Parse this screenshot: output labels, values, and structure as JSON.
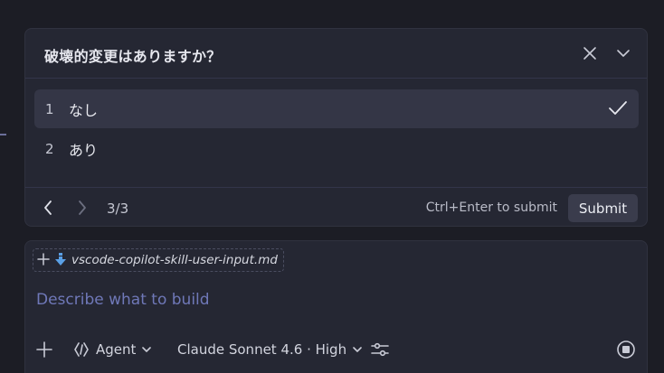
{
  "question": {
    "title": "破壊的変更はありますか？",
    "options": [
      {
        "num": "1",
        "label": "なし",
        "selected": true
      },
      {
        "num": "2",
        "label": "あり",
        "selected": false
      }
    ],
    "counter": "3/3",
    "hint": "Ctrl+Enter to submit",
    "submit_label": "Submit"
  },
  "chat": {
    "attachment": "vscode-copilot-skill-user-input.md",
    "placeholder": "Describe what to build",
    "mode_label": "Agent",
    "model_label": "Claude Sonnet 4.6 · High"
  },
  "icons": {
    "close": "close-icon",
    "collapse": "chevron-down-icon",
    "check": "check-icon",
    "prev": "chevron-left-icon",
    "next": "chevron-right-icon",
    "attach_add": "plus-icon",
    "download": "arrow-down-icon",
    "agent": "agent-icon",
    "settings": "sliders-icon",
    "stop": "stop-icon"
  },
  "colors": {
    "background": "#1c1d25",
    "panel": "#252733",
    "selected_row": "#343646",
    "placeholder": "#6f78b8",
    "download_icon": "#5aa0e6"
  }
}
